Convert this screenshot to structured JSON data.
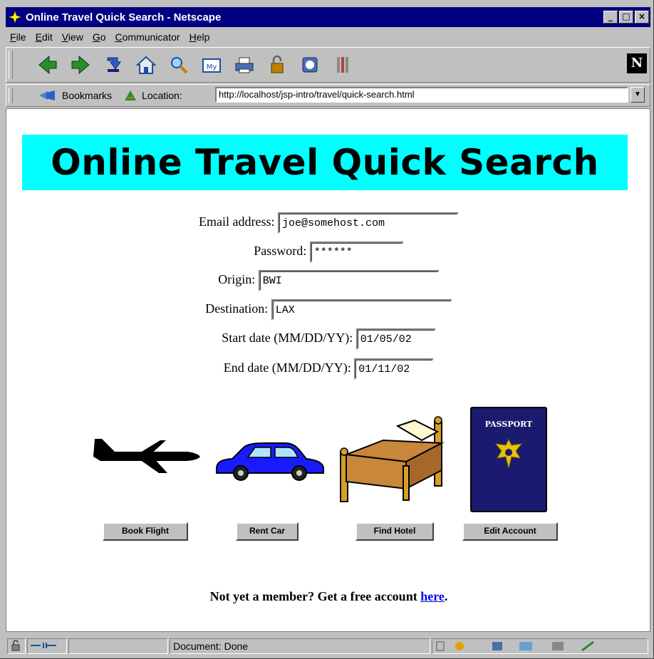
{
  "window": {
    "title": "Online Travel Quick Search - Netscape",
    "min_glyph": "_",
    "max_glyph": "□",
    "close_glyph": "×"
  },
  "menu": [
    "File",
    "Edit",
    "View",
    "Go",
    "Communicator",
    "Help"
  ],
  "toolbar": {
    "icons": [
      "back-icon",
      "forward-icon",
      "reload-icon",
      "home-icon",
      "search-icon",
      "my-netscape-icon",
      "print-icon",
      "security-icon",
      "shop-icon",
      "stop-icon"
    ],
    "logo": "N"
  },
  "location_bar": {
    "bookmarks_label": "Bookmarks",
    "location_label": "Location:",
    "url": "http://localhost/jsp-intro/travel/quick-search.html",
    "dropdown_glyph": "▼"
  },
  "page": {
    "heading": "Online Travel Quick Search",
    "form": {
      "email_label": "Email address:",
      "email_value": "joe@somehost.com",
      "password_label": "Password:",
      "password_value": "******",
      "origin_label": "Origin:",
      "origin_value": "BWI",
      "destination_label": "Destination:",
      "destination_value": "LAX",
      "start_label": "Start date (MM/DD/YY):",
      "start_value": "01/05/02",
      "end_label": "End date (MM/DD/YY):",
      "end_value": "01/11/02"
    },
    "passport_text": "PASSPORT",
    "buttons": {
      "flight": "Book Flight",
      "car": "Rent Car",
      "hotel": "Find Hotel",
      "account": "Edit Account"
    },
    "member_prefix": "Not yet a member? Get a free account ",
    "member_link": "here",
    "member_suffix": "."
  },
  "status": {
    "text": "Document: Done"
  },
  "colors": {
    "banner": "#00ffff",
    "titlebar": "#000080",
    "link": "#0000ee"
  }
}
